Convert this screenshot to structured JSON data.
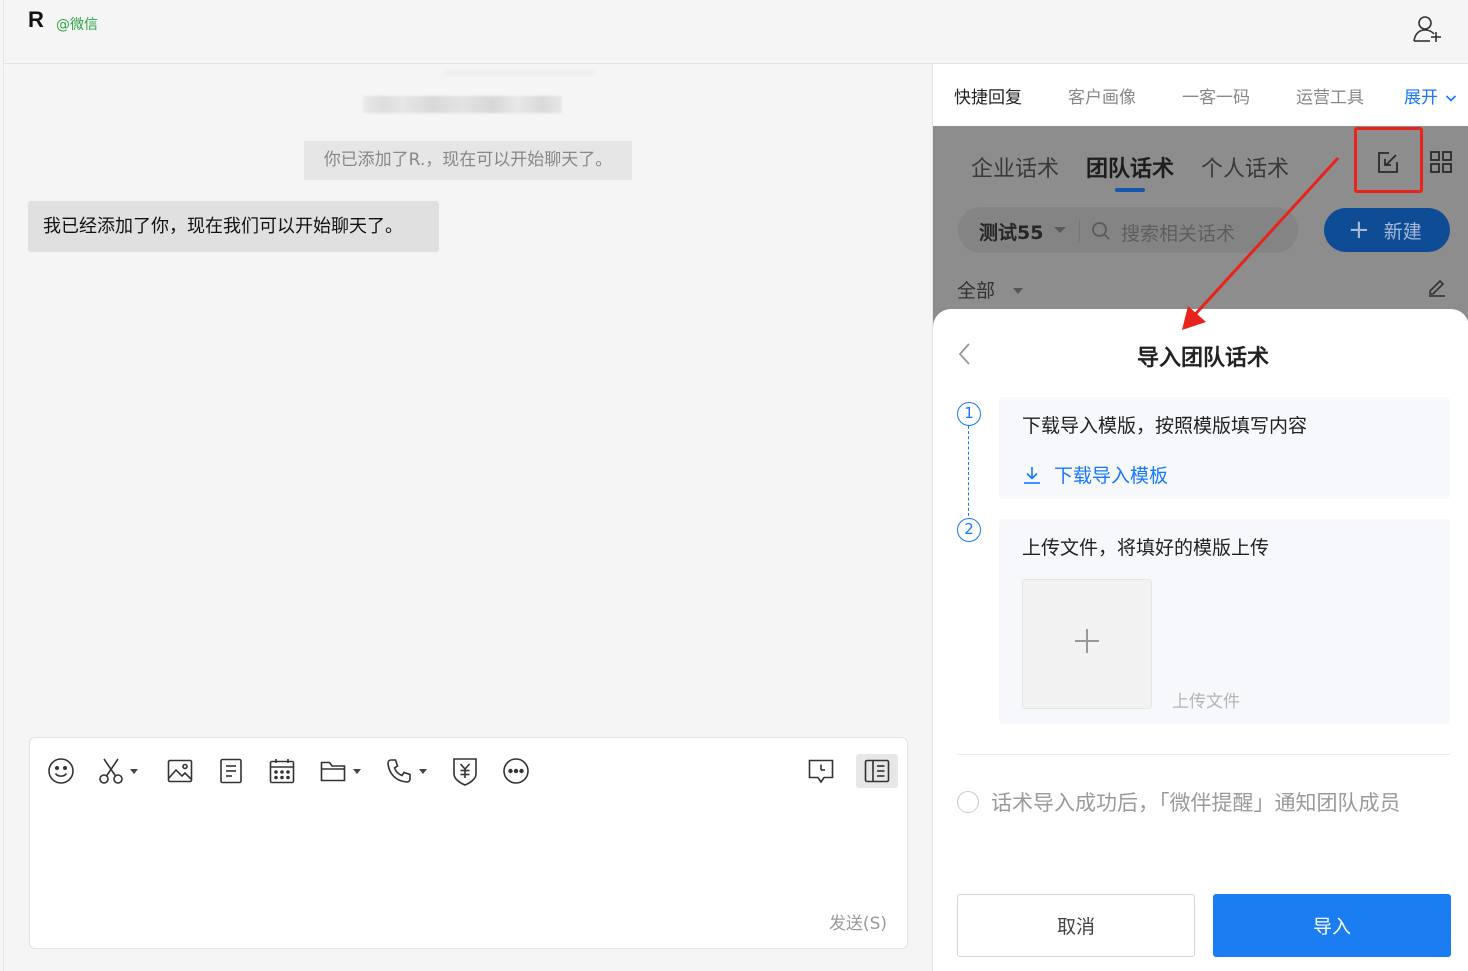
{
  "header": {
    "contact_name": "R",
    "contact_source": "@微信",
    "add_member_icon": "add-user-icon"
  },
  "chat": {
    "system_message": "你已添加了R.，现在可以开始聊天了。",
    "messages": [
      {
        "text": "我已经添加了你，现在我们可以开始聊天了。"
      }
    ]
  },
  "composer": {
    "tools": [
      "emoji-icon",
      "scissors-icon",
      "image-icon",
      "document-icon",
      "calendar-icon",
      "folder-icon",
      "phone-icon",
      "payment-icon",
      "more-icon",
      "chat-history-icon",
      "side-panel-icon"
    ],
    "send_label": "发送(S)"
  },
  "right_panel": {
    "tabs": [
      {
        "label": "快捷回复",
        "active": true
      },
      {
        "label": "客户画像",
        "active": false
      },
      {
        "label": "一客一码",
        "active": false
      },
      {
        "label": "运营工具",
        "active": false
      }
    ],
    "expand_label": "展开",
    "sub_tabs": [
      {
        "label": "企业话术",
        "active": false
      },
      {
        "label": "团队话术",
        "active": true
      },
      {
        "label": "个人话术",
        "active": false
      }
    ],
    "group_select": "测试55",
    "search_placeholder": "搜索相关话术",
    "new_button": "新建",
    "filter_label": "全部"
  },
  "import_dialog": {
    "title": "导入团队话术",
    "step1": {
      "number": "1",
      "text": "下载导入模版，按照模版填写内容",
      "link": "下载导入模板"
    },
    "step2": {
      "number": "2",
      "text": "上传文件，将填好的模版上传",
      "upload_hint": "上传文件"
    },
    "notify_text": "话术导入成功后，「微伴提醒」通知团队成员",
    "cancel_label": "取消",
    "import_label": "导入"
  },
  "colors": {
    "accent": "#1677ff",
    "import_button": "#1a7ef2",
    "highlight": "#e8231c",
    "wechat_green": "#2ba245"
  }
}
